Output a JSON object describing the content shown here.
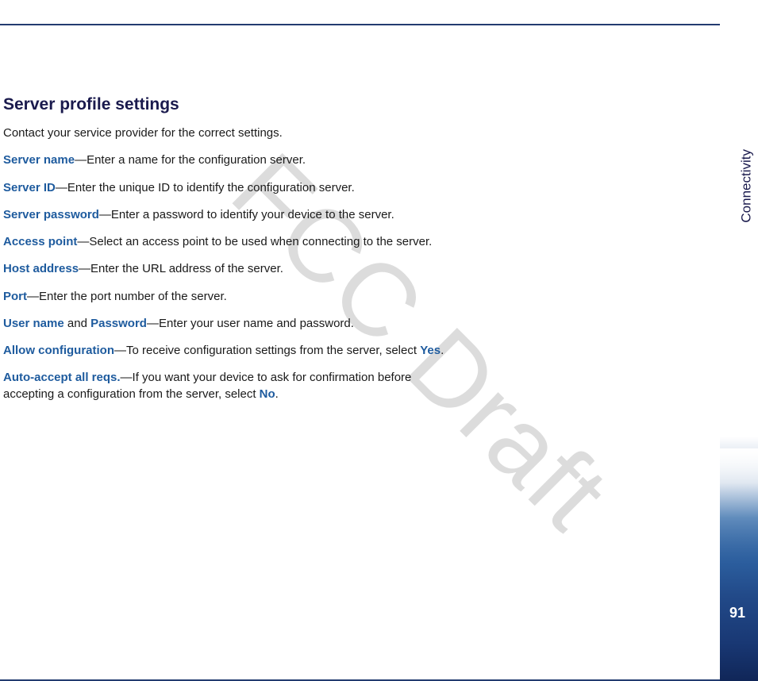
{
  "heading": "Server profile settings",
  "intro": "Contact your service provider for the correct settings.",
  "items": [
    {
      "term": "Server name",
      "desc": "—Enter a name for the configuration server."
    },
    {
      "term": "Server ID",
      "desc": "—Enter the unique ID to identify the configuration server."
    },
    {
      "term": "Server password",
      "desc": "—Enter a password to identify your device to the server."
    },
    {
      "term": "Access point",
      "desc": "—Select an access point to be used when connecting to the server."
    },
    {
      "term": "Host address",
      "desc": "—Enter the URL address of the server."
    },
    {
      "term": "Port",
      "desc": "—Enter the port number of the server."
    }
  ],
  "usernamePassword": {
    "term1": "User name",
    "conjunction": " and ",
    "term2": "Password",
    "desc": "—Enter your user name and password."
  },
  "allowConfig": {
    "term": "Allow configuration",
    "desc_before": "—To receive configuration settings from the server, select ",
    "choice": "Yes",
    "desc_after": "."
  },
  "autoAccept": {
    "term": "Auto-accept all reqs.",
    "desc_before": "—If you want your device to ask for confirmation before accepting a configuration from the server, select ",
    "choice": "No",
    "desc_after": "."
  },
  "sidebar": {
    "section": "Connectivity",
    "pageNumber": "91"
  },
  "watermark": "FCC Draft"
}
